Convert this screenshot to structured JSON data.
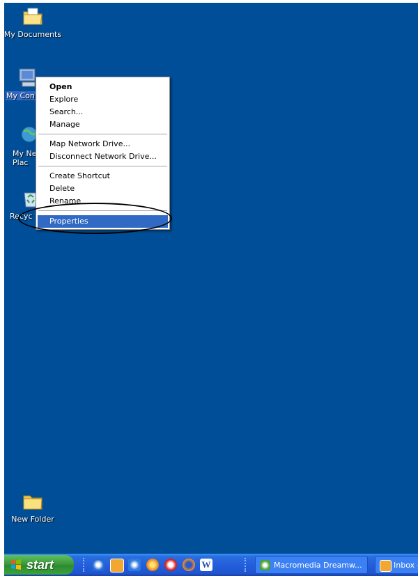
{
  "desktop": {
    "icons": [
      {
        "label": "My Documents"
      },
      {
        "label": "My Con"
      },
      {
        "label": "My Ne Plac"
      },
      {
        "label": "Recyc"
      },
      {
        "label": "New Folder"
      }
    ]
  },
  "context_menu": {
    "items": [
      {
        "label": "Open",
        "default": true
      },
      {
        "label": "Explore"
      },
      {
        "label": "Search..."
      },
      {
        "label": "Manage"
      },
      {
        "label": "Map Network Drive..."
      },
      {
        "label": "Disconnect Network Drive..."
      },
      {
        "label": "Create Shortcut"
      },
      {
        "label": "Delete"
      },
      {
        "label": "Rename"
      },
      {
        "label": "Properties",
        "highlighted": true
      }
    ]
  },
  "taskbar": {
    "start_label": "start",
    "quick_launch": [
      "internet-explorer-icon",
      "outlook-icon",
      "browser-icon",
      "media-player-icon",
      "opera-icon",
      "firefox-icon",
      "word-icon"
    ],
    "buttons": [
      {
        "label": "Macromedia Dreamw...",
        "icon": "dreamweaver-icon"
      },
      {
        "label": "Inbox -",
        "icon": "outlook-icon"
      }
    ]
  },
  "colors": {
    "desktop": "#004e98",
    "menu_highlight": "#316ac5",
    "taskbar": "#245edc",
    "start_button": "#3c9a3c"
  }
}
